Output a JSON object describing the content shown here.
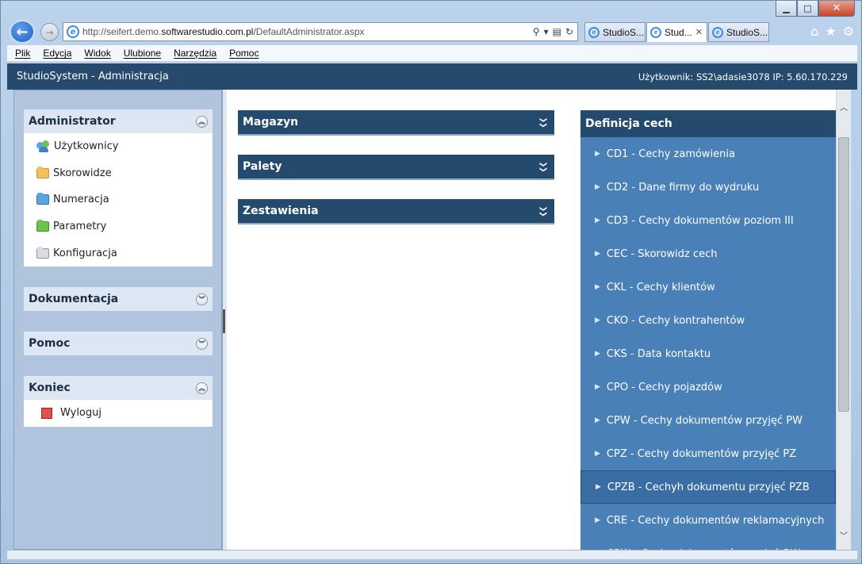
{
  "browser": {
    "url_prefix": "http://seifert.demo.",
    "url_domain": "softwarestudio.com.pl",
    "url_path": "/DefaultAdministrator.aspx",
    "tabs": [
      {
        "label": "StudioS...",
        "active": false
      },
      {
        "label": "Stud...",
        "active": true
      },
      {
        "label": "StudioS...",
        "active": false
      }
    ],
    "tab_close": "✕"
  },
  "menu": [
    "Plik",
    "Edycja",
    "Widok",
    "Ulubione",
    "Narzędzia",
    "Pomoc"
  ],
  "app": {
    "title": "StudioSystem - Administracja",
    "user_info": "Użytkownik: SS2\\adasie3078 IP: 5.60.170.229"
  },
  "sidebar": {
    "administrator": {
      "title": "Administrator",
      "items": [
        "Użytkownicy",
        "Skorowidze",
        "Numeracja",
        "Parametry",
        "Konfiguracja"
      ]
    },
    "dokumentacja": {
      "title": "Dokumentacja"
    },
    "pomoc": {
      "title": "Pomoc"
    },
    "koniec": {
      "title": "Koniec",
      "items": [
        "Wyloguj"
      ]
    }
  },
  "main": {
    "sections": [
      "Magazyn",
      "Palety",
      "Zestawienia"
    ],
    "definitions": {
      "title": "Definicja cech",
      "selected_index": 10,
      "items": [
        "CD1 - Cechy zamówienia",
        "CD2 - Dane firmy do wydruku",
        "CD3 - Cechy dokumentów poziom III",
        "CEC - Skorowidz cech",
        "CKL - Cechy klientów",
        "CKO - Cechy kontrahentów",
        "CKS - Data kontaktu",
        "CPO - Cechy pojazdów",
        "CPW - Cechy dokumentów przyjęć PW",
        "CPZ - Cechy dokumentów przyjęć PZ",
        "CPZB - Cechyh dokumentu przyjęć PZB",
        "CRE - Cechy dokumentów reklamacyjnych",
        "CRW - Cechy dokumentów wydań RW"
      ]
    }
  },
  "colors": {
    "header": "#264a6e",
    "panel_blue": "#4a80b8",
    "sidebar_bg": "#b0c4de"
  }
}
